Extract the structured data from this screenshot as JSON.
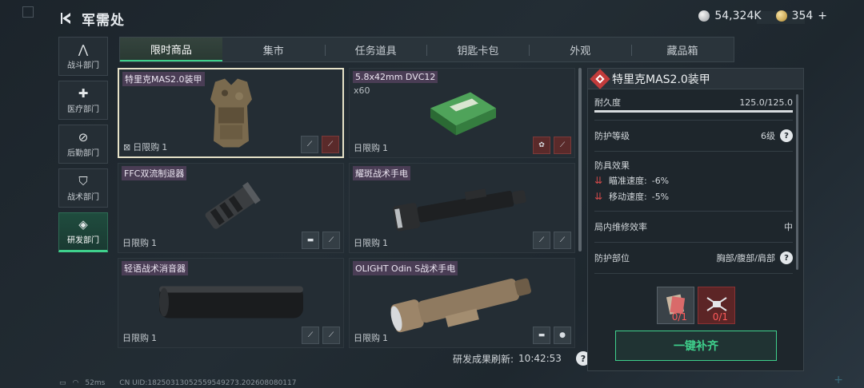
{
  "header": {
    "title": "军需处"
  },
  "currency": {
    "silver": "54,324K",
    "gold": "354"
  },
  "sidenav": [
    {
      "label": "战斗部门",
      "icon": "combat-icon",
      "glyph": "⋀"
    },
    {
      "label": "医疗部门",
      "icon": "medical-icon",
      "glyph": "✚"
    },
    {
      "label": "后勤部门",
      "icon": "logistics-icon",
      "glyph": "⊘"
    },
    {
      "label": "战术部门",
      "icon": "tactical-icon",
      "glyph": "⛉"
    },
    {
      "label": "研发部门",
      "icon": "research-icon",
      "glyph": "◈"
    }
  ],
  "tabs": [
    "限时商品",
    "集市",
    "任务道具",
    "钥匙卡包",
    "外观",
    "藏品箱"
  ],
  "items": [
    {
      "title": "特里克MAS2.0装甲",
      "sub": "",
      "limit_label": "日限购",
      "limit_value": "1"
    },
    {
      "title": "5.8x42mm DVC12",
      "sub": "x60",
      "limit_label": "日限购",
      "limit_value": "1"
    },
    {
      "title": "FFC双流制退器",
      "sub": "",
      "limit_label": "日限购",
      "limit_value": "1"
    },
    {
      "title": "耀斑战术手电",
      "sub": "",
      "limit_label": "日限购",
      "limit_value": "1"
    },
    {
      "title": "轻语战术消音器",
      "sub": "",
      "limit_label": "日限购",
      "limit_value": "1"
    },
    {
      "title": "OLIGHT Odin S战术手电",
      "sub": "",
      "limit_label": "日限购",
      "limit_value": "1"
    }
  ],
  "refresh": {
    "label": "研发成果刷新:",
    "time": "10:42:53"
  },
  "detail": {
    "title": "特里克MAS2.0装甲",
    "durability_label": "耐久度",
    "durability_value": "125.0/125.0",
    "durability_fraction": 1.0,
    "protection_label": "防护等级",
    "protection_value": "6级",
    "effects_label": "防具效果",
    "effects": [
      {
        "label": "瞄准速度:",
        "value": "-6%"
      },
      {
        "label": "移动速度:",
        "value": "-5%"
      }
    ],
    "repair_label": "局内维修效率",
    "repair_value": "中",
    "area_label": "防护部位",
    "area_value": "胸部/腹部/肩部",
    "req1_count": "0/1",
    "req2_count": "0/1",
    "supply_button": "一键补齐"
  },
  "status": {
    "ping": "52ms",
    "uid": "CN UID:18250313052559549273.202608080117"
  },
  "colors": {
    "accent": "#3fd08c",
    "selected_border": "#e6e2c8",
    "title_tag": "#4a3d55",
    "danger": "#c23b3b"
  }
}
